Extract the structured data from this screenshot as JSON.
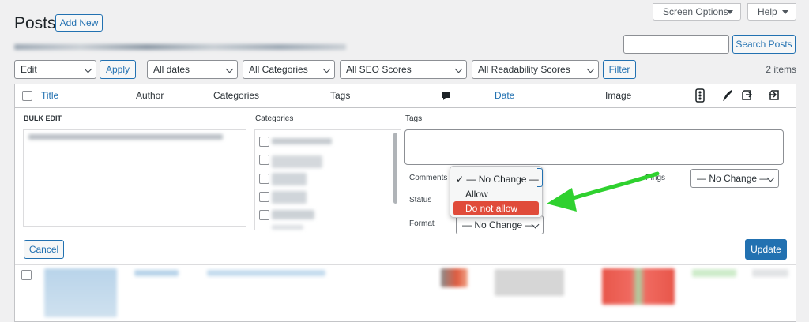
{
  "header": {
    "title": "Posts",
    "add_new": "Add New",
    "screen_options": "Screen Options",
    "help": "Help"
  },
  "search": {
    "value": "",
    "button": "Search Posts"
  },
  "filters": {
    "bulk_action": "Edit",
    "apply": "Apply",
    "dates": "All dates",
    "categories": "All Categories",
    "seo": "All SEO Scores",
    "readability": "All Readability Scores",
    "filter": "Filter",
    "count": "2 items"
  },
  "columns": {
    "title": "Title",
    "author": "Author",
    "categories": "Categories",
    "tags": "Tags",
    "date": "Date",
    "image": "Image"
  },
  "bulk_edit": {
    "heading": "BULK EDIT",
    "categories_label": "Categories",
    "tags_label": "Tags",
    "comments_label": "Comments",
    "status_label": "Status",
    "format_label": "Format",
    "pings_label": "Pings",
    "format_value": "— No Change —",
    "pings_value": "— No Change —",
    "cancel": "Cancel",
    "update": "Update"
  },
  "comments_dropdown": {
    "check": "✓",
    "options": [
      "— No Change —",
      "Allow",
      "Do not allow"
    ],
    "highlighted": "Do not allow"
  },
  "colors": {
    "accent": "#2271b1",
    "highlight": "#e04b3a",
    "arrow": "#2fd12f"
  },
  "icons": [
    "comment-icon",
    "traffic-light-icon",
    "pen-icon",
    "outgoing-links-icon",
    "incoming-links-icon"
  ]
}
